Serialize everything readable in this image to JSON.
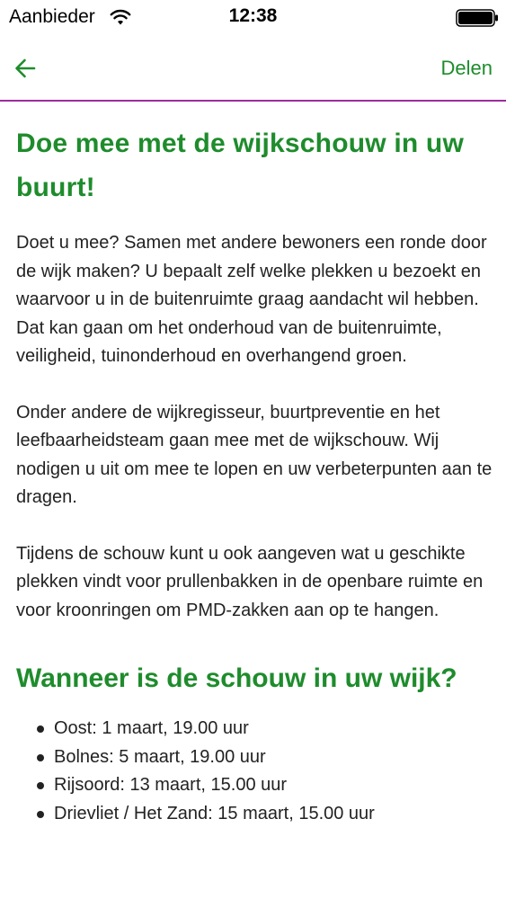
{
  "status_bar": {
    "carrier": "Aanbieder",
    "time": "12:38"
  },
  "nav": {
    "share_label": "Delen"
  },
  "colors": {
    "accent_green": "#1e8c2c",
    "nav_divider": "#9b2c9e"
  },
  "icons": {
    "wifi": "wifi-icon",
    "battery": "battery-icon",
    "back": "arrow-left-icon"
  },
  "article": {
    "title": "Doe mee met de wijkschouw in uw buurt!",
    "paragraphs": [
      "Doet u mee? Samen met andere bewoners een ronde door de wijk maken? U bepaalt zelf welke plekken u bezoekt en waarvoor u in de buitenruimte graag aandacht wil hebben. Dat kan gaan om het onderhoud van de buitenruimte, veiligheid, tuinonderhoud en overhangend groen.",
      "Onder andere de wijkregisseur, buurtpreventie en het leefbaarheidsteam gaan mee met de wijkschouw. Wij nodigen u uit om mee te lopen en uw verbeterpunten aan te dragen.",
      "Tijdens de schouw kunt u ook aangeven wat u geschikte plekken vindt voor prullenbakken in de openbare ruimte en voor kroonringen om PMD-zakken aan op te hangen."
    ],
    "schedule_heading": "Wanneer is de schouw in uw wijk?",
    "schedule": [
      "Oost: 1 maart, 19.00 uur",
      "Bolnes: 5 maart, 19.00 uur",
      "Rijsoord: 13 maart, 15.00 uur",
      "Drievliet / Het Zand: 15 maart, 15.00 uur"
    ]
  }
}
